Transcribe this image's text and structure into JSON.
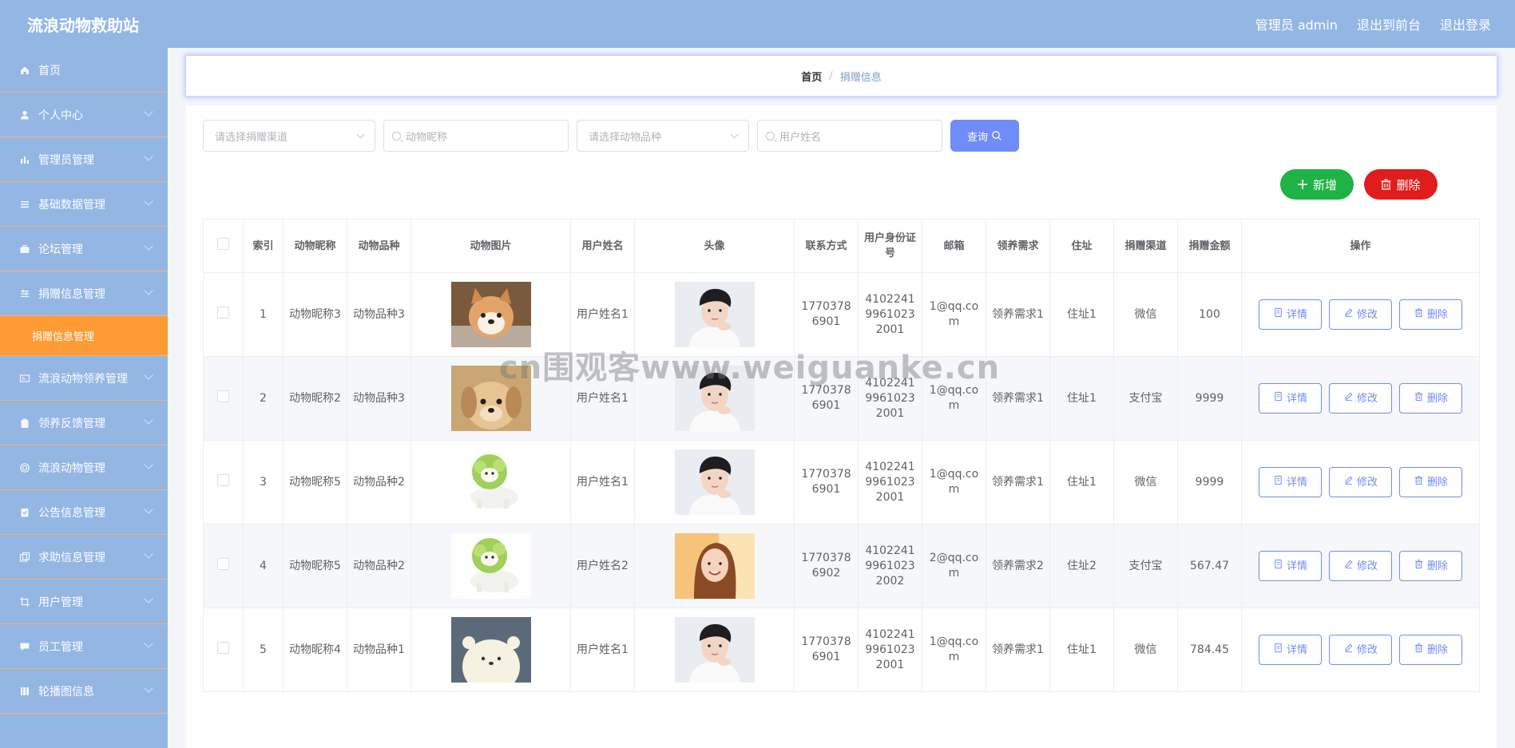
{
  "header": {
    "title": "流浪动物救助站",
    "admin": "管理员 admin",
    "front": "退出到前台",
    "logout": "退出登录"
  },
  "sidebar": {
    "items": [
      {
        "label": "首页",
        "icon": "home-icon"
      },
      {
        "label": "个人中心",
        "icon": "user-icon"
      },
      {
        "label": "管理员管理",
        "icon": "chart-icon"
      },
      {
        "label": "基础数据管理",
        "icon": "list-icon"
      },
      {
        "label": "论坛管理",
        "icon": "briefcase-icon"
      },
      {
        "label": "捐赠信息管理",
        "icon": "sliders-icon"
      },
      {
        "label": "流浪动物领养管理",
        "icon": "card-icon"
      },
      {
        "label": "领养反馈管理",
        "icon": "clipboard-icon"
      },
      {
        "label": "流浪动物管理",
        "icon": "target-icon"
      },
      {
        "label": "公告信息管理",
        "icon": "doc-icon"
      },
      {
        "label": "求助信息管理",
        "icon": "copy-icon"
      },
      {
        "label": "用户管理",
        "icon": "crop-icon"
      },
      {
        "label": "员工管理",
        "icon": "chat-icon"
      },
      {
        "label": "轮播图信息",
        "icon": "book-icon"
      }
    ],
    "active_sub": "捐赠信息管理"
  },
  "breadcrumb": {
    "home": "首页",
    "sep": "/",
    "current": "捐赠信息"
  },
  "filters": {
    "channel_placeholder": "请选择捐赠渠道",
    "nickname_placeholder": "动物昵称",
    "breed_placeholder": "请选择动物品种",
    "username_placeholder": "用户姓名",
    "query_label": "查询"
  },
  "actions": {
    "add_label": "新增",
    "delete_label": "删除"
  },
  "table": {
    "headers": [
      "索引",
      "动物昵称",
      "动物品种",
      "动物图片",
      "用户姓名",
      "头像",
      "联系方式",
      "用户身份证号",
      "邮箱",
      "领养需求",
      "住址",
      "捐赠渠道",
      "捐赠金额",
      "操作"
    ],
    "op_labels": {
      "detail": "详情",
      "edit": "修改",
      "delete": "删除"
    },
    "rows": [
      {
        "index": "1",
        "nickname": "动物昵称3",
        "breed": "动物品种3",
        "animal_img": "shiba-dog",
        "username": "用户姓名1",
        "avatar": "male-avatar",
        "phone": "17703786901",
        "idcard": "410224199610232001",
        "email": "1@qq.com",
        "need": "领养需求1",
        "address": "住址1",
        "channel": "微信",
        "amount": "100"
      },
      {
        "index": "2",
        "nickname": "动物昵称2",
        "breed": "动物品种3",
        "animal_img": "puppy",
        "username": "用户姓名1",
        "avatar": "male-avatar",
        "phone": "17703786901",
        "idcard": "410224199610232001",
        "email": "1@qq.com",
        "need": "领养需求1",
        "address": "住址1",
        "channel": "支付宝",
        "amount": "9999"
      },
      {
        "index": "3",
        "nickname": "动物昵称5",
        "breed": "动物品种2",
        "animal_img": "cabbage-dog",
        "username": "用户姓名1",
        "avatar": "male-avatar",
        "phone": "17703786901",
        "idcard": "410224199610232001",
        "email": "1@qq.com",
        "need": "领养需求1",
        "address": "住址1",
        "channel": "微信",
        "amount": "9999"
      },
      {
        "index": "4",
        "nickname": "动物昵称5",
        "breed": "动物品种2",
        "animal_img": "cabbage-dog",
        "username": "用户姓名2",
        "avatar": "female-avatar",
        "phone": "17703786902",
        "idcard": "410224199610232002",
        "email": "2@qq.com",
        "need": "领养需求2",
        "address": "住址2",
        "channel": "支付宝",
        "amount": "567.47"
      },
      {
        "index": "5",
        "nickname": "动物昵称4",
        "breed": "动物品种1",
        "animal_img": "bear",
        "username": "用户姓名1",
        "avatar": "male-avatar",
        "phone": "17703786901",
        "idcard": "410224199610232001",
        "email": "1@qq.com",
        "need": "领养需求1",
        "address": "住址1",
        "channel": "微信",
        "amount": "784.45"
      }
    ]
  },
  "watermark": "cn围观客www.weiguanke.cn"
}
